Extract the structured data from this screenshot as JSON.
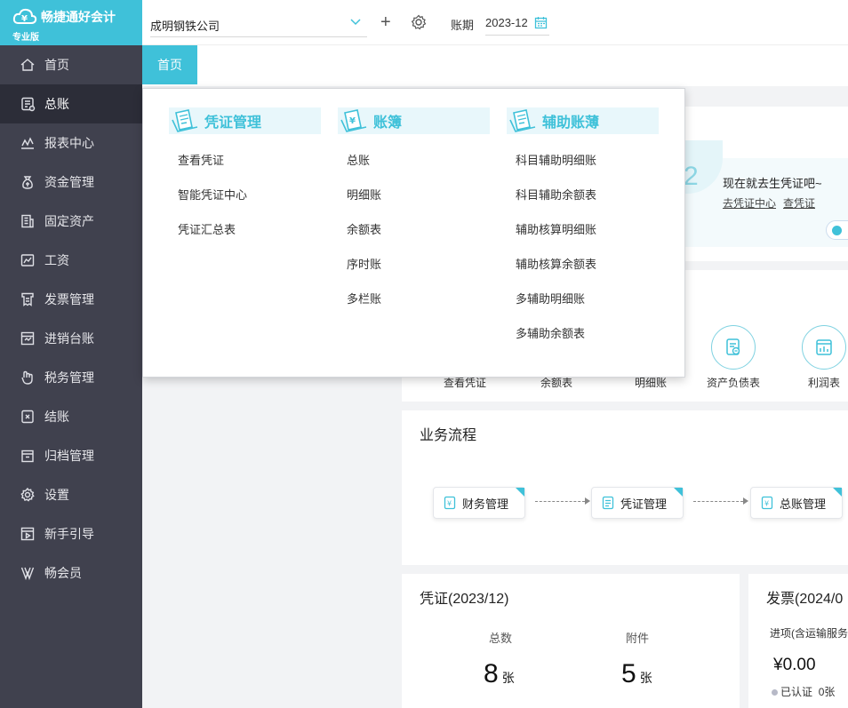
{
  "app": {
    "brand": "畅捷通好会计",
    "edition": "专业版"
  },
  "sidebar": {
    "items": [
      {
        "label": "首页",
        "icon": "home-icon"
      },
      {
        "label": "总账",
        "icon": "ledger-icon"
      },
      {
        "label": "报表中心",
        "icon": "report-icon"
      },
      {
        "label": "资金管理",
        "icon": "money-bag-icon"
      },
      {
        "label": "固定资产",
        "icon": "building-icon"
      },
      {
        "label": "工资",
        "icon": "salary-icon"
      },
      {
        "label": "发票管理",
        "icon": "invoice-icon"
      },
      {
        "label": "进销台账",
        "icon": "inventory-icon"
      },
      {
        "label": "税务管理",
        "icon": "tax-icon"
      },
      {
        "label": "结账",
        "icon": "close-account-icon"
      },
      {
        "label": "归档管理",
        "icon": "archive-icon"
      },
      {
        "label": "设置",
        "icon": "gear-icon"
      },
      {
        "label": "新手引导",
        "icon": "video-guide-icon"
      },
      {
        "label": "畅会员",
        "icon": "vip-icon"
      }
    ],
    "active_index": 1
  },
  "topbar": {
    "company": "成明钢铁公司",
    "period_label": "账期",
    "period_value": "2023-12"
  },
  "tabs": {
    "home": "首页"
  },
  "dropdown": {
    "columns": [
      {
        "title": "凭证管理",
        "items": [
          "查看凭证",
          "智能凭证中心",
          "凭证汇总表"
        ]
      },
      {
        "title": "账簿",
        "items": [
          "总账",
          "明细账",
          "余额表",
          "序时账",
          "多栏账"
        ]
      },
      {
        "title": "辅助账薄",
        "items": [
          "科目辅助明细账",
          "科目辅助余额表",
          "辅助核算明细账",
          "辅助核算余额表",
          "多辅助明细账",
          "多辅助余额表"
        ]
      }
    ]
  },
  "banner": {
    "number": "2",
    "message": "现在就去生凭证吧~",
    "link1": "去凭证中心",
    "link2": "查凭证"
  },
  "quick": {
    "items": [
      "查看凭证",
      "余额表",
      "明细账",
      "资产负债表",
      "利润表"
    ]
  },
  "flow": {
    "title": "业务流程",
    "steps": [
      "财务管理",
      "凭证管理",
      "总账管理"
    ]
  },
  "voucher": {
    "title": "凭证(2023/12)",
    "total_label": "总数",
    "total_value": "8",
    "attach_label": "附件",
    "attach_value": "5",
    "unit": "张"
  },
  "invoice": {
    "title": "发票(2024/0",
    "subtitle": "进项(含运输服务",
    "amount": "¥0.00",
    "certified_label": "已认证",
    "certified_value": "0张"
  },
  "colors": {
    "accent": "#3fc1d9",
    "sidebar_bg": "#40414e",
    "sidebar_active": "#2c2d38"
  }
}
